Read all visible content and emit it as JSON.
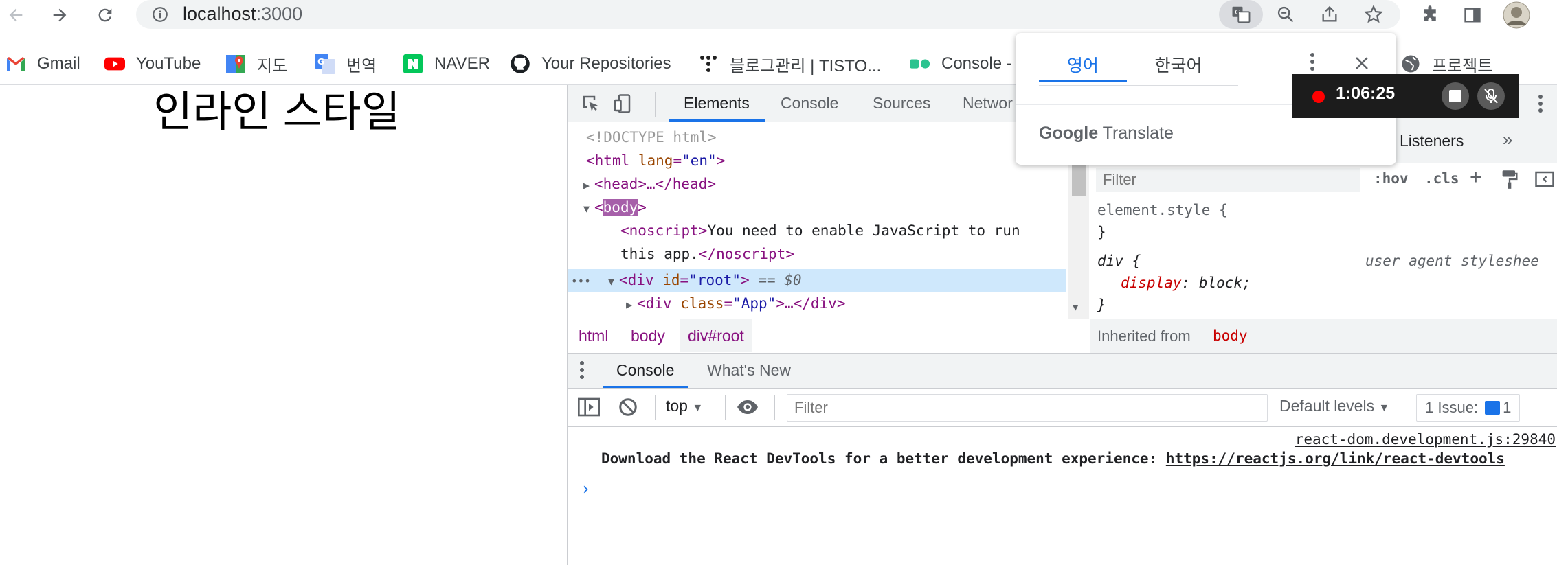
{
  "browser": {
    "url_host": "localhost",
    "url_port": ":3000",
    "bookmarks": [
      "Gmail",
      "YouTube",
      "지도",
      "번역",
      "NAVER",
      "Your Repositories",
      "블로그관리 | TISTO...",
      "Console -",
      "프로젝트"
    ]
  },
  "page": {
    "heading": "인라인 스타일"
  },
  "devtools": {
    "tabs": [
      "Elements",
      "Console",
      "Sources",
      "Networ"
    ],
    "elements": {
      "doctype": "<!DOCTYPE html>",
      "html_open": "<html",
      "html_attr": "lang",
      "html_val": "\"en\"",
      "head": "<head>…</head>",
      "body_tag": "body",
      "noscript_open": "<noscript>",
      "noscript_text1": "You need to enable JavaScript to run",
      "noscript_text2": "this app.",
      "noscript_close": "</noscript>",
      "div_open": "<div",
      "div_attr": "id",
      "div_val": "\"root\"",
      "div_eq": "== $0",
      "app_open": "<div",
      "app_attr": "class",
      "app_val": "\"App\"",
      "app_close": ">…</div>",
      "ellipsis": "•••"
    },
    "breadcrumbs": [
      "html",
      "body",
      "div#root"
    ],
    "styles": {
      "subtab": "Listeners",
      "more": "»",
      "filter_placeholder": "Filter",
      "hov": ":hov",
      "cls": ".cls",
      "element_style": "element.style {",
      "close_brace": "}",
      "div_selector": "div {",
      "ua_label": "user agent styleshee",
      "prop_name": "display",
      "prop_value": "block;",
      "inherited_label": "Inherited from",
      "inherited_from": "body"
    },
    "drawer_tabs": [
      "Console",
      "What's New"
    ],
    "console": {
      "context": "top",
      "filter_placeholder": "Filter",
      "levels": "Default levels",
      "issues_label": "1 Issue:",
      "issues_count": "1",
      "source": "react-dom.development.js:29840",
      "message": "Download the React DevTools for a better development experience: ",
      "link": "https://reactjs.org/link/react-devtools",
      "prompt": "›"
    }
  },
  "translate_popup": {
    "languages": [
      "영어",
      "한국어"
    ],
    "brand_google": "Google",
    "brand_translate": "Translate"
  },
  "recorder": {
    "time": "1:06:25"
  },
  "colors": {
    "accent": "#1a73e8",
    "tag": "#881280",
    "attr": "#994500",
    "value": "#1a1aa6",
    "record": "#ff0000"
  }
}
